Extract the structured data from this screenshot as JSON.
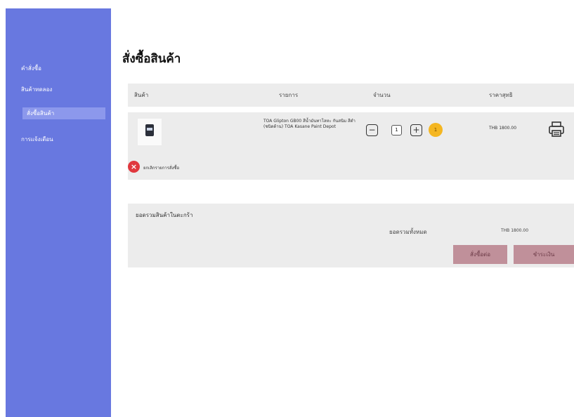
{
  "sidebar": {
    "items": [
      {
        "label": "คำสั่งซื้อ"
      },
      {
        "label": "สินค้าทดลอง"
      },
      {
        "label": "สั่งซื้อสินค้า"
      },
      {
        "label": "การแจ้งเตือน"
      }
    ]
  },
  "page": {
    "title": "สั่งซื้อสินค้า"
  },
  "table": {
    "headers": {
      "product": "สินค้า",
      "details": "รายการ",
      "quantity": "จำนวน",
      "total": "ราคาสุทธิ"
    },
    "row": {
      "description": "TOA Glipton GB00 สีน้ำมันทาโลหะ กันสนิม สีดำ (ชนิดด้าน) TOA Kasane Paint Depot",
      "qty_minus": "−",
      "qty_value": "1",
      "qty_plus": "+",
      "badge": "1",
      "price": "THB 1800.00",
      "remove_label": "ยกเลิกรายการสั่งซื้อ"
    }
  },
  "summary": {
    "title": "ยอดรวมสินค้าในตะกร้า",
    "total_label": "ยอดรวมทั้งหมด",
    "total_value": "THB 1800.00",
    "order_button": "สั่งซื้อต่อ",
    "checkout_button": "ชำระเงิน"
  },
  "colors": {
    "sidebar": "#6878e0",
    "panel": "#ececec",
    "button": "#c0909a",
    "badge": "#f4b621",
    "remove": "#e0383e"
  }
}
